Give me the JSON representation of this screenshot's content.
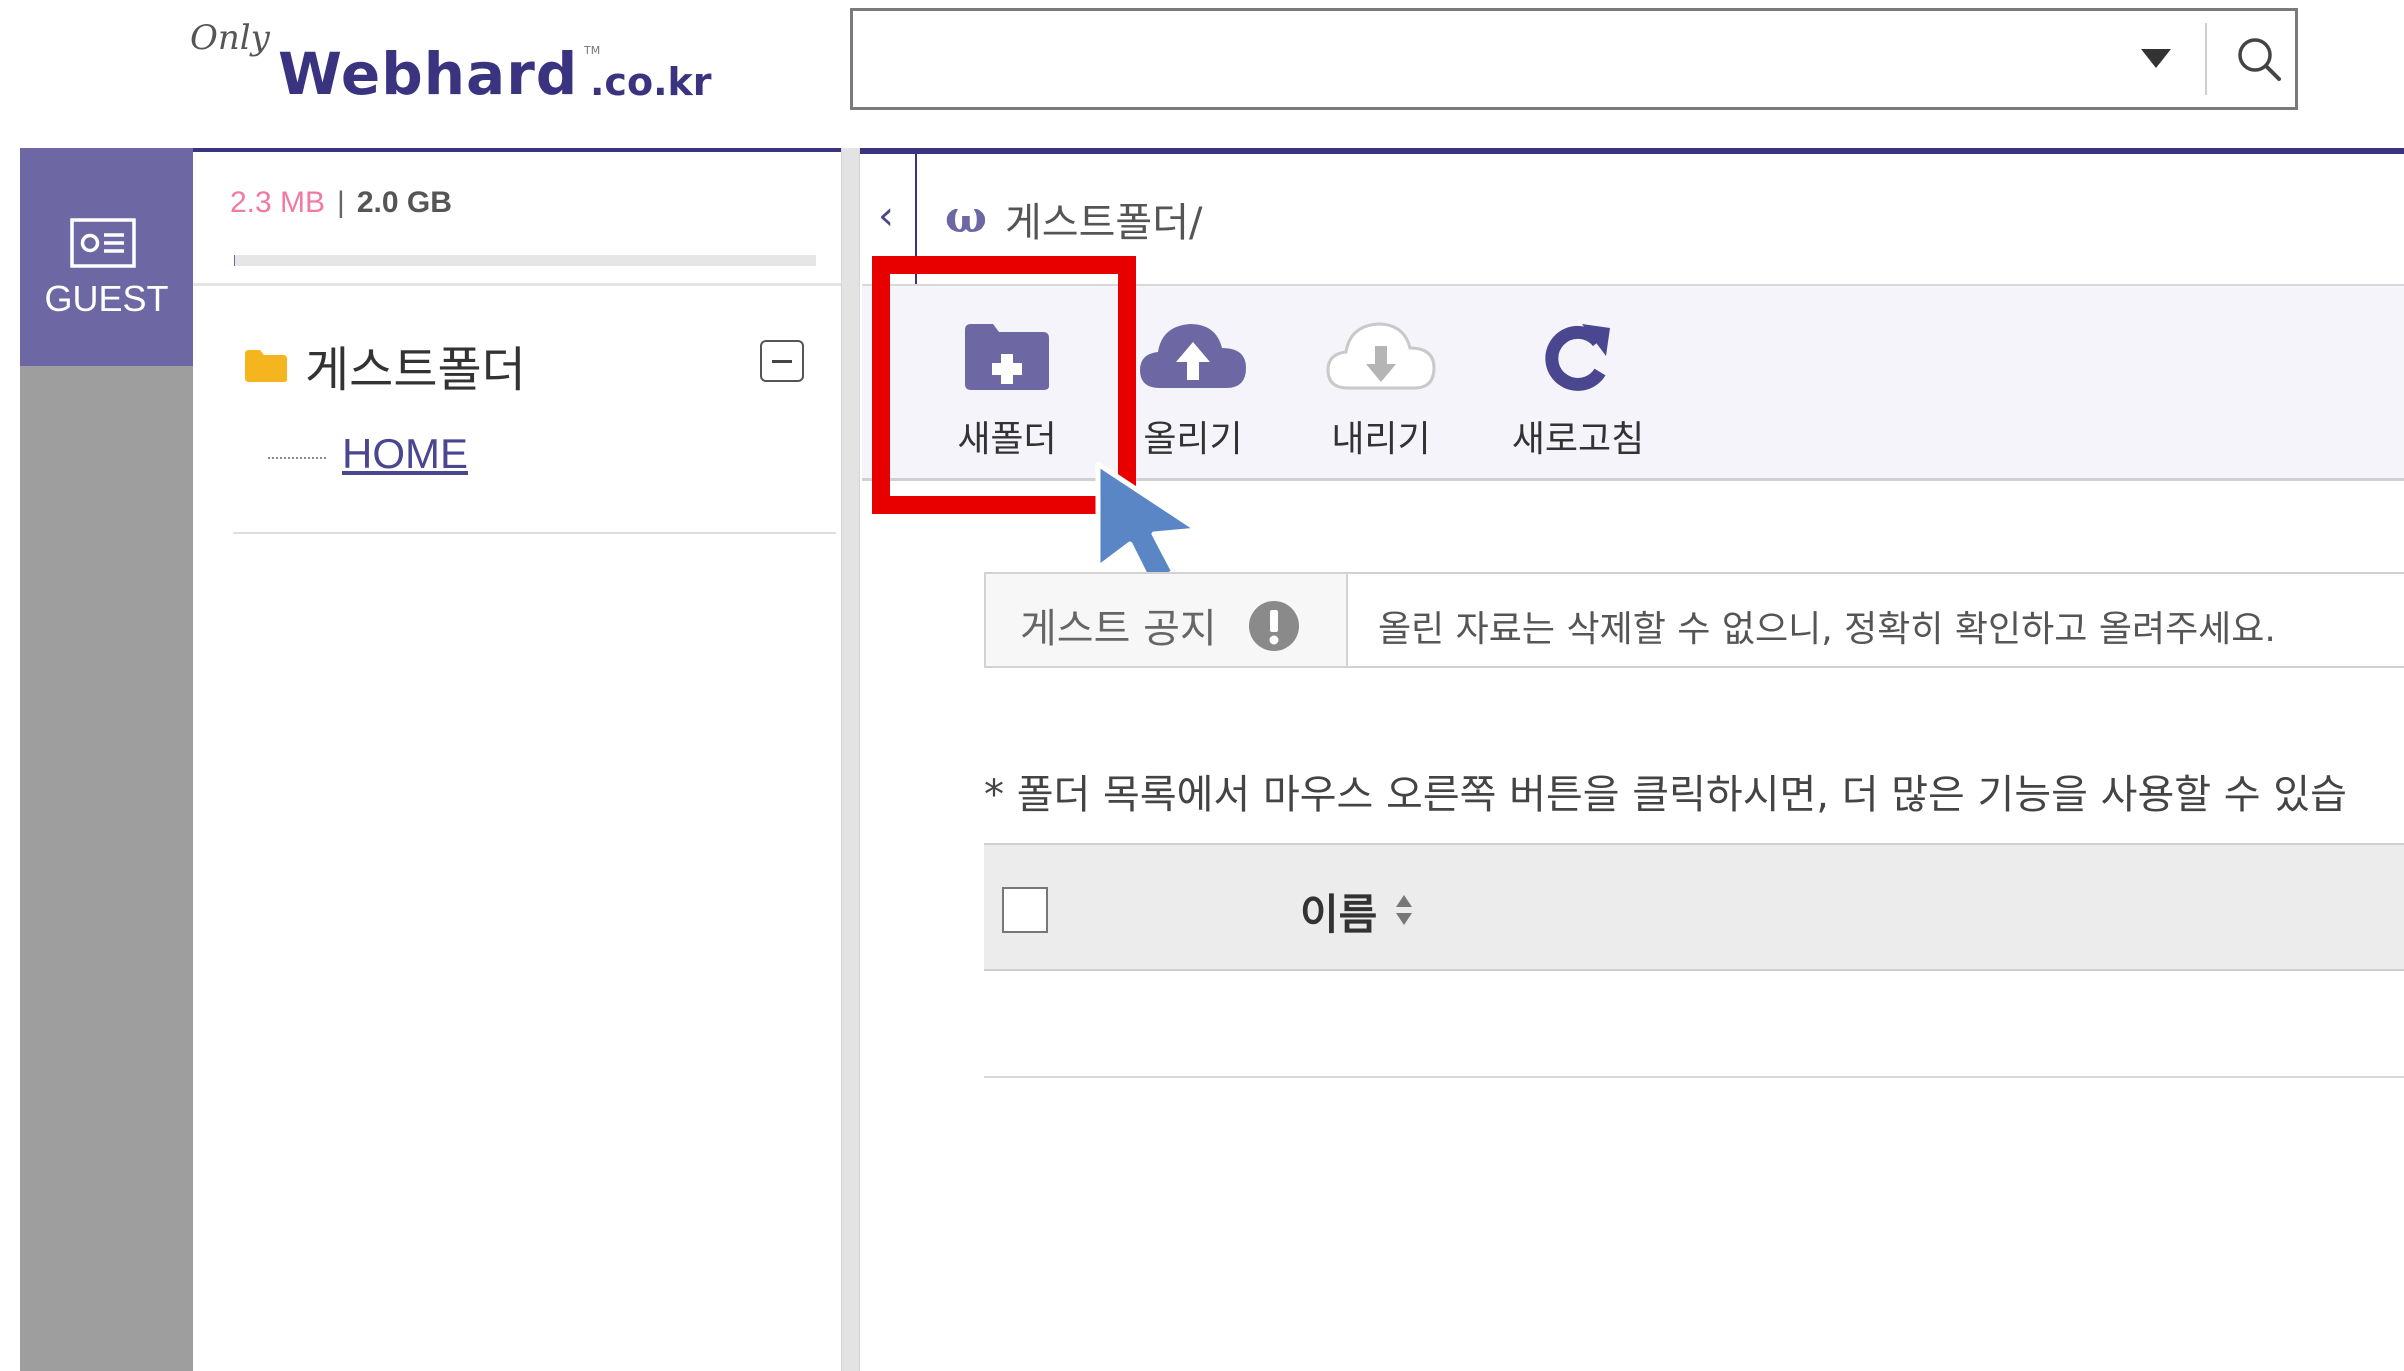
{
  "header": {
    "logo_only": "Only",
    "logo_main": "Webhard",
    "logo_tld": ".co.kr",
    "logo_tm": "TM",
    "search": {
      "value": "",
      "placeholder": ""
    }
  },
  "sidebar": {
    "guest_label": "GUEST",
    "usage": {
      "used": "2.3 MB",
      "separator": "|",
      "total": "2.0 GB",
      "fraction_used": 0.0011
    },
    "tree": {
      "root_label": "게스트폴더",
      "child_label": "HOME"
    }
  },
  "main": {
    "collapse_glyph": "‹",
    "path_logo": "ω",
    "path": "게스트폴더/",
    "toolbar": {
      "new_folder": "새폴더",
      "upload": "올리기",
      "download": "내리기",
      "refresh": "새로고침"
    },
    "notice": {
      "label": "게스트 공지",
      "text": "올린 자료는 삭제할 수 없으니, 정확히 확인하고 올려주세요."
    },
    "hint": "* 폴더 목록에서 마우스 오른쪽 버튼을 클릭하시면, 더 많은 기능을 사용할 수 있습",
    "table": {
      "columns": [
        "이름"
      ]
    }
  },
  "colors": {
    "brand": "#3a3480",
    "accent": "#6d68a3",
    "highlight": "#e80000",
    "pointer": "#5a86c5",
    "folder": "#f5b51e",
    "usage_used": "#f07aa0"
  },
  "icons": [
    "search-icon",
    "dropdown-arrow-icon",
    "id-card-icon",
    "folder-icon",
    "collapse-icon",
    "new-folder-icon",
    "upload-cloud-icon",
    "download-cloud-icon",
    "refresh-icon",
    "exclamation-icon",
    "sort-icon",
    "cursor-arrow-icon"
  ]
}
